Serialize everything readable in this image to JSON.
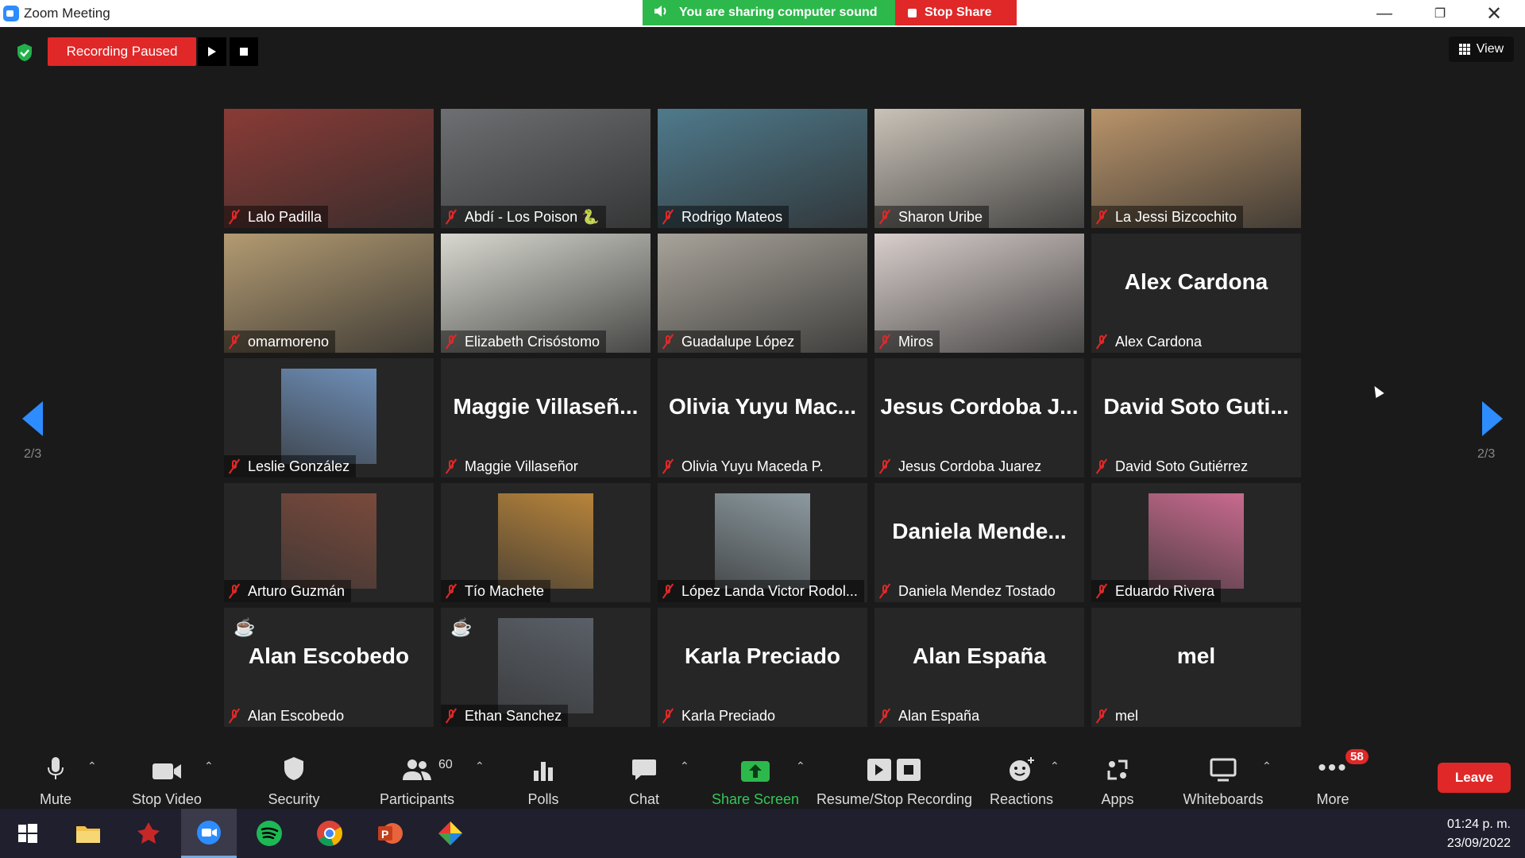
{
  "window": {
    "title": "Zoom Meeting"
  },
  "sharing": {
    "status": "You are sharing computer sound",
    "stop_label": "Stop Share"
  },
  "recording": {
    "label": "Recording Paused"
  },
  "view": {
    "label": "View"
  },
  "pagination": {
    "left": "2/3",
    "right": "2/3"
  },
  "participants": [
    {
      "name": "Lalo Padilla",
      "display": "video",
      "color": "#8a3b36"
    },
    {
      "name": "Abdí - Los Poison 🐍",
      "display": "video",
      "color": "#6d6f72"
    },
    {
      "name": "Rodrigo Mateos",
      "display": "video",
      "color": "#4f7a8c"
    },
    {
      "name": "Sharon Uribe",
      "display": "video",
      "color": "#c9c2b8"
    },
    {
      "name": "La Jessi Bizcochito",
      "display": "video",
      "color": "#b9946a"
    },
    {
      "name": "omarmoreno",
      "display": "video",
      "color": "#b39b72"
    },
    {
      "name": "Elizabeth Crisóstomo",
      "display": "video",
      "color": "#d8d8d0"
    },
    {
      "name": "Guadalupe López",
      "display": "video",
      "color": "#a8a39a"
    },
    {
      "name": "Miros",
      "display": "video",
      "color": "#d9cfcc"
    },
    {
      "name": "Alex Cardona",
      "display": "text",
      "big": "Alex Cardona"
    },
    {
      "name": "Leslie González",
      "display": "photo",
      "color": "#6e8fb8"
    },
    {
      "name": "Maggie Villaseñor",
      "display": "text",
      "big": "Maggie Villaseñ..."
    },
    {
      "name": "Olivia Yuyu Maceda P.",
      "display": "text",
      "big": "Olivia Yuyu Mac..."
    },
    {
      "name": "Jesus Cordoba Juarez",
      "display": "text",
      "big": "Jesus Cordoba J..."
    },
    {
      "name": "David Soto Gutiérrez",
      "display": "text",
      "big": "David Soto Guti..."
    },
    {
      "name": "Arturo Guzmán",
      "display": "photo",
      "color": "#7a4a3c"
    },
    {
      "name": "Tío Machete",
      "display": "photo",
      "color": "#b8843a"
    },
    {
      "name": "López Landa Victor Rodol...",
      "display": "photo",
      "color": "#8c9aa0"
    },
    {
      "name": "Daniela Mendez Tostado",
      "display": "text",
      "big": "Daniela Mende..."
    },
    {
      "name": "Eduardo Rivera",
      "display": "photo",
      "color": "#c96a8e"
    },
    {
      "name": "Alan Escobedo",
      "display": "text",
      "big": "Alan Escobedo",
      "cup": true
    },
    {
      "name": "Ethan Sanchez",
      "display": "photo",
      "color": "#5a6068",
      "cup": true
    },
    {
      "name": "Karla Preciado",
      "display": "text",
      "big": "Karla Preciado"
    },
    {
      "name": "Alan España",
      "display": "text",
      "big": "Alan España"
    },
    {
      "name": "mel",
      "display": "text",
      "big": "mel"
    }
  ],
  "toolbar": {
    "mute": "Mute",
    "stop_video": "Stop Video",
    "security": "Security",
    "participants": "Participants",
    "participants_count": "60",
    "polls": "Polls",
    "chat": "Chat",
    "share_screen": "Share Screen",
    "resume_stop_recording": "Resume/Stop Recording",
    "reactions": "Reactions",
    "apps": "Apps",
    "whiteboards": "Whiteboards",
    "more": "More",
    "more_badge": "58",
    "leave": "Leave"
  },
  "taskbar": {
    "time": "01:24 p. m.",
    "date": "23/09/2022"
  },
  "colors": {
    "accent": "#2D8CFF",
    "danger": "#e02828",
    "share_green": "#2db84c",
    "tile_bg": "#262626"
  }
}
